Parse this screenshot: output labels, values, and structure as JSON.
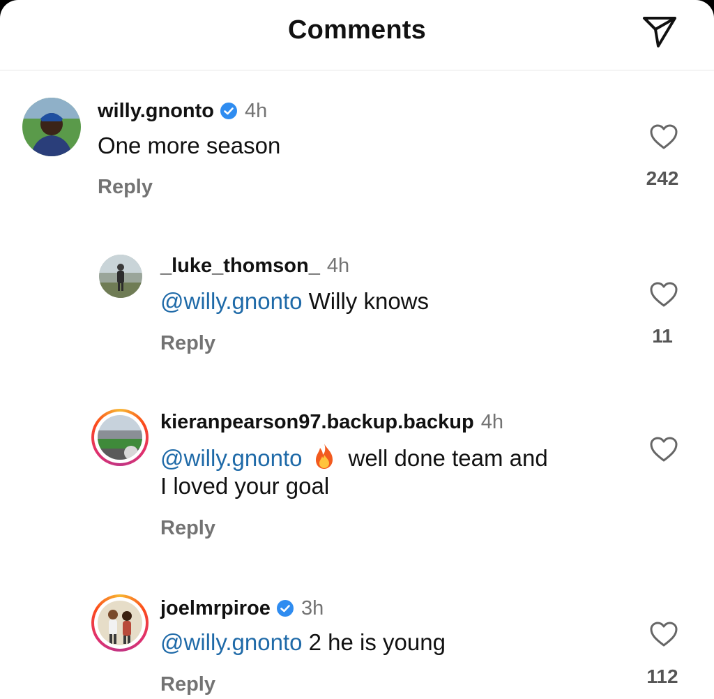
{
  "header": {
    "title": "Comments",
    "send_icon": "paper-plane-icon"
  },
  "comments": [
    {
      "username": "willy.gnonto",
      "verified": true,
      "time": "4h",
      "mention": "",
      "text": "One more season",
      "text_line2": "",
      "reply_label": "Reply",
      "likes": "242"
    },
    {
      "username": "_luke_thomson_",
      "verified": false,
      "time": "4h",
      "mention": "@willy.gnonto",
      "text": "Willy knows",
      "text_line2": "",
      "reply_label": "Reply",
      "likes": "11"
    },
    {
      "username": "kieranpearson97.backup.backup",
      "verified": false,
      "time": "4h",
      "mention": "@willy.gnonto",
      "emoji": "fire-icon",
      "text": "well done team and",
      "text_line2": "I loved your goal",
      "reply_label": "Reply",
      "likes": ""
    },
    {
      "username": "joelmrpiroe",
      "verified": true,
      "time": "3h",
      "mention": "@willy.gnonto",
      "text": "2 he is young",
      "text_line2": "",
      "reply_label": "Reply",
      "likes": "112"
    }
  ],
  "colors": {
    "mention": "#1f6aa8",
    "verified": "#2f8cf0",
    "muted": "#737373"
  }
}
